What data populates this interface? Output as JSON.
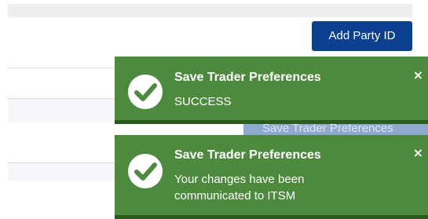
{
  "toolbar": {
    "add_party_label": "Add Party ID"
  },
  "background": {
    "save_button_label": "Save Trader Preferences"
  },
  "toasts": [
    {
      "title": "Save Trader Preferences",
      "message": "SUCCESS",
      "close": "×"
    },
    {
      "title": "Save Trader Preferences",
      "message_lines": [
        "Your changes have been",
        "communicated to ITSM"
      ],
      "close": "×"
    }
  ],
  "colors": {
    "toast_background": "#4e8a3e",
    "toast_bar": "#2c5b22",
    "primary_button": "#0b3f8f",
    "background_button": "#8fa9cf"
  },
  "icons": {
    "toast_icon": "check-circle-icon",
    "toast_close": "close-icon"
  }
}
